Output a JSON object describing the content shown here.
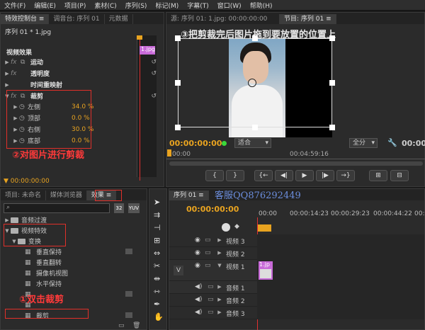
{
  "menu": [
    "文件(F)",
    "编辑(E)",
    "项目(P)",
    "素材(C)",
    "序列(S)",
    "标记(M)",
    "字幕(T)",
    "窗口(W)",
    "帮助(H)"
  ],
  "effect_controls": {
    "tabs": [
      "特效控制台 ≡",
      "调音台: 序列 01",
      "元数据"
    ],
    "clip_path": "序列 01 * 1.jpg",
    "clip_label": "1.jpg",
    "section_title": "视频效果",
    "effects": [
      "运动",
      "透明度",
      "时间重映射"
    ],
    "crop_title": "裁剪",
    "crop_params": [
      {
        "name": "左侧",
        "value": "34.0 %"
      },
      {
        "name": "顶部",
        "value": "0.0 %"
      },
      {
        "name": "右侧",
        "value": "30.0 %"
      },
      {
        "name": "底部",
        "value": "0.0 %"
      }
    ],
    "timecode": "00:00:00:00",
    "annotation": "②对图片进行剪裁"
  },
  "source_monitor": {
    "tab": "源: 序列 01: 1.jpg: 00:00:00:00"
  },
  "program_monitor": {
    "tab": "节目: 序列 01 ≡",
    "annotation": "③把剪裁完后图片拖到要放置的位置上",
    "timecode_current": "00:00:00:00",
    "fit": "适合",
    "ruler_start": "00:00",
    "ruler_mid": "00:04:59:16",
    "quality": "全分",
    "timecode_end": "00:00"
  },
  "project_panel": {
    "tabs": [
      "项目: 未命名",
      "媒体浏览器",
      "效果 ≡"
    ],
    "search_placeholder": "",
    "items": [
      {
        "label": "音频过渡",
        "level": 0,
        "type": "folder"
      },
      {
        "label": "视频特效",
        "level": 0,
        "type": "folder"
      },
      {
        "label": "变换",
        "level": 1,
        "type": "folder"
      },
      {
        "label": "垂直保持",
        "level": 2,
        "type": "fx"
      },
      {
        "label": "垂直翻转",
        "level": 2,
        "type": "fx"
      },
      {
        "label": "摄像机视图",
        "level": 2,
        "type": "fx"
      },
      {
        "label": "水平保持",
        "level": 2,
        "type": "fx"
      },
      {
        "label": "",
        "level": 2,
        "type": "fx"
      },
      {
        "label": "",
        "level": 2,
        "type": "fx"
      },
      {
        "label": "裁剪",
        "level": 2,
        "type": "fx"
      }
    ],
    "annotation": "①双击裁剪"
  },
  "timeline": {
    "tab": "序列 01 ≡",
    "watermark": "客服QQ876292449",
    "timecode": "00:00:00:00",
    "ruler": [
      "00:00",
      "00:00:14:23",
      "00:00:29:23",
      "00:00:44:22",
      "00:00:59:"
    ],
    "tracks": [
      {
        "label": "视频 3",
        "kind": "video"
      },
      {
        "label": "视频 2",
        "kind": "video"
      },
      {
        "label": "视频 1",
        "kind": "video"
      },
      {
        "label": "音频 1",
        "kind": "audio"
      },
      {
        "label": "音频 2",
        "kind": "audio"
      },
      {
        "label": "音频 3",
        "kind": "audio"
      }
    ],
    "clip_label": "1.jp"
  }
}
